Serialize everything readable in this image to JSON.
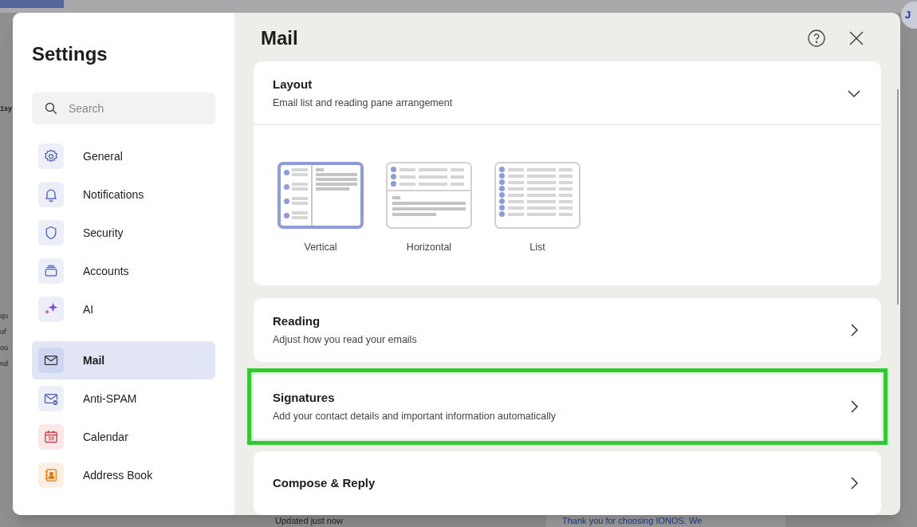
{
  "background": {
    "avatar_initial": "J",
    "left_fragments": [
      "1sy",
      "qu",
      "of",
      "ou",
      "nd"
    ],
    "status_text": "Updated just now",
    "preview_text": "Thank you for choosing IONOS. We"
  },
  "sidebar": {
    "title": "Settings",
    "search": {
      "placeholder": "Search"
    },
    "items": [
      {
        "label": "General",
        "kind": "gear",
        "selected": false
      },
      {
        "label": "Notifications",
        "kind": "bell",
        "selected": false
      },
      {
        "label": "Security",
        "kind": "shield",
        "selected": false
      },
      {
        "label": "Accounts",
        "kind": "stack",
        "selected": false
      },
      {
        "label": "AI",
        "kind": "sparkle",
        "selected": false
      },
      {
        "label": "Mail",
        "kind": "mail",
        "selected": true
      },
      {
        "label": "Anti-SPAM",
        "kind": "spam",
        "selected": false
      },
      {
        "label": "Calendar",
        "kind": "calendar",
        "selected": false
      },
      {
        "label": "Address Book",
        "kind": "contact",
        "selected": false
      }
    ]
  },
  "main": {
    "title": "Mail",
    "layout_card": {
      "title": "Layout",
      "subtitle": "Email list and reading pane arrangement",
      "expanded": true,
      "options": [
        {
          "label": "Vertical",
          "kind": "vertical",
          "selected": true
        },
        {
          "label": "Horizontal",
          "kind": "horizontal",
          "selected": false
        },
        {
          "label": "List",
          "kind": "list",
          "selected": false
        }
      ]
    },
    "cards": [
      {
        "title": "Reading",
        "subtitle": "Adjust how you read your emails",
        "highlighted": false
      },
      {
        "title": "Signatures",
        "subtitle": "Add your contact details and important information automatically",
        "highlighted": true
      },
      {
        "title": "Compose & Reply",
        "highlighted": false
      }
    ]
  }
}
